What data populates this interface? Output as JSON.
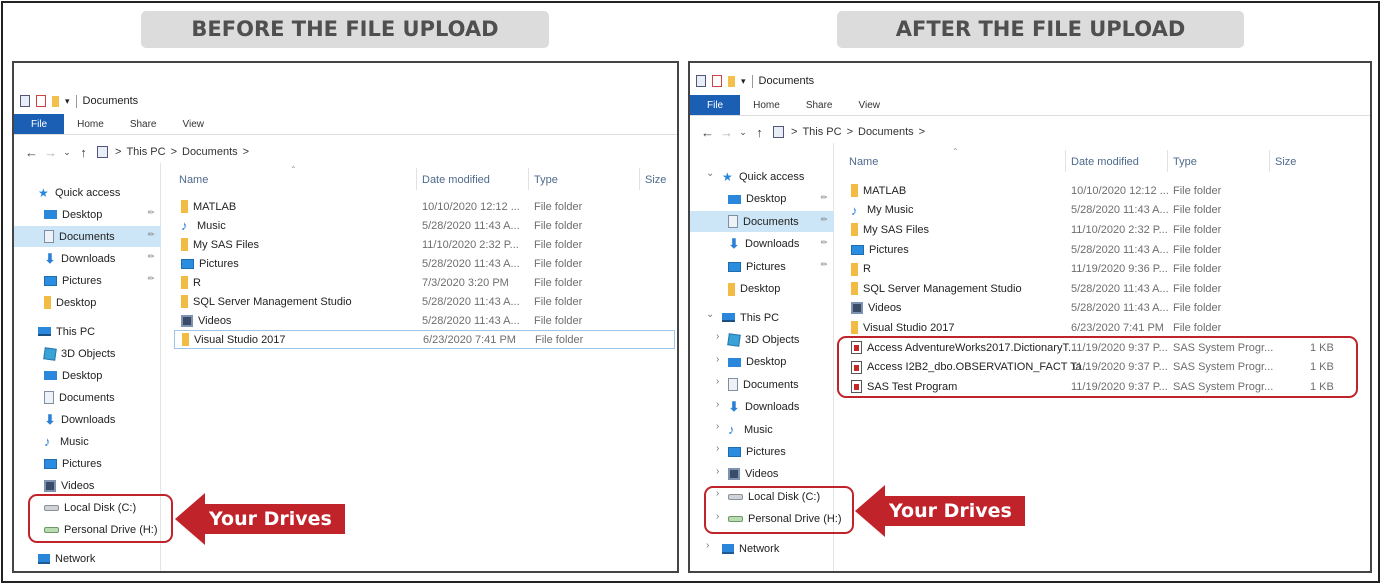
{
  "headings": {
    "before": "BEFORE THE FILE UPLOAD",
    "after": "AFTER THE FILE UPLOAD"
  },
  "window": {
    "title": "Documents",
    "ribbon_tabs": [
      "File",
      "Home",
      "Share",
      "View"
    ],
    "address": {
      "segments": [
        "This PC",
        "Documents"
      ],
      "separator": ">"
    }
  },
  "nav_glyphs": {
    "back": "←",
    "forward": "→",
    "recent": "⌄",
    "up": "↑",
    "expand": "›",
    "expanded": "⌄",
    "pin": "📌"
  },
  "columns": {
    "name": "Name",
    "date": "Date modified",
    "type": "Type",
    "size": "Size"
  },
  "before": {
    "nav": {
      "quick_access": "Quick access",
      "quick_items": [
        "Desktop",
        "Documents",
        "Downloads",
        "Pictures",
        "Desktop"
      ],
      "this_pc": "This PC",
      "pc_items": [
        "3D Objects",
        "Desktop",
        "Documents",
        "Downloads",
        "Music",
        "Pictures",
        "Videos",
        "Local Disk (C:)",
        "Personal Drive (H:)"
      ],
      "network": "Network"
    },
    "files": [
      {
        "name": "MATLAB",
        "date": "10/10/2020 12:12 ...",
        "type": "File folder",
        "size": "",
        "icon": "folder-icon"
      },
      {
        "name": "Music",
        "date": "5/28/2020 11:43 A...",
        "type": "File folder",
        "size": "",
        "icon": "music-icon"
      },
      {
        "name": "My SAS Files",
        "date": "11/10/2020 2:32 P...",
        "type": "File folder",
        "size": "",
        "icon": "folder-icon"
      },
      {
        "name": "Pictures",
        "date": "5/28/2020 11:43 A...",
        "type": "File folder",
        "size": "",
        "icon": "pictures-icon"
      },
      {
        "name": "R",
        "date": "7/3/2020 3:20 PM",
        "type": "File folder",
        "size": "",
        "icon": "folder-icon"
      },
      {
        "name": "SQL Server Management Studio",
        "date": "5/28/2020 11:43 A...",
        "type": "File folder",
        "size": "",
        "icon": "folder-icon"
      },
      {
        "name": "Videos",
        "date": "5/28/2020 11:43 A...",
        "type": "File folder",
        "size": "",
        "icon": "videos-icon"
      },
      {
        "name": "Visual Studio 2017",
        "date": "6/23/2020 7:41 PM",
        "type": "File folder",
        "size": "",
        "icon": "folder-icon"
      }
    ]
  },
  "after": {
    "nav": {
      "quick_access": "Quick access",
      "quick_items": [
        "Desktop",
        "Documents",
        "Downloads",
        "Pictures",
        "Desktop"
      ],
      "this_pc": "This PC",
      "pc_items": [
        "3D Objects",
        "Desktop",
        "Documents",
        "Downloads",
        "Music",
        "Pictures",
        "Videos",
        "Local Disk (C:)",
        "Personal Drive (H:)"
      ],
      "network": "Network"
    },
    "files": [
      {
        "name": "MATLAB",
        "date": "10/10/2020 12:12 ...",
        "type": "File folder",
        "size": "",
        "icon": "folder-icon"
      },
      {
        "name": "My Music",
        "date": "5/28/2020 11:43 A...",
        "type": "File folder",
        "size": "",
        "icon": "music-icon"
      },
      {
        "name": "My SAS Files",
        "date": "11/10/2020 2:32 P...",
        "type": "File folder",
        "size": "",
        "icon": "folder-icon"
      },
      {
        "name": "Pictures",
        "date": "5/28/2020 11:43 A...",
        "type": "File folder",
        "size": "",
        "icon": "pictures-icon"
      },
      {
        "name": "R",
        "date": "11/19/2020 9:36 P...",
        "type": "File folder",
        "size": "",
        "icon": "folder-icon"
      },
      {
        "name": "SQL Server Management Studio",
        "date": "5/28/2020 11:43 A...",
        "type": "File folder",
        "size": "",
        "icon": "folder-icon"
      },
      {
        "name": "Videos",
        "date": "5/28/2020 11:43 A...",
        "type": "File folder",
        "size": "",
        "icon": "videos-icon"
      },
      {
        "name": "Visual Studio 2017",
        "date": "6/23/2020 7:41 PM",
        "type": "File folder",
        "size": "",
        "icon": "folder-icon"
      },
      {
        "name": "Access AdventureWorks2017.DictionaryT...",
        "date": "11/19/2020 9:37 P...",
        "type": "SAS System Progr...",
        "size": "1 KB",
        "icon": "sas-program-icon"
      },
      {
        "name": "Access I2B2_dbo.OBSERVATION_FACT Ta...",
        "date": "11/19/2020 9:37 P...",
        "type": "SAS System Progr...",
        "size": "1 KB",
        "icon": "sas-program-icon"
      },
      {
        "name": "SAS Test Program",
        "date": "11/19/2020 9:37 P...",
        "type": "SAS System Progr...",
        "size": "1 KB",
        "icon": "sas-program-icon"
      }
    ]
  },
  "callout": {
    "label": "Your Drives"
  },
  "colors": {
    "accent": "#1a5fb4",
    "highlight": "#c0232a",
    "selected": "#cde6f7"
  }
}
